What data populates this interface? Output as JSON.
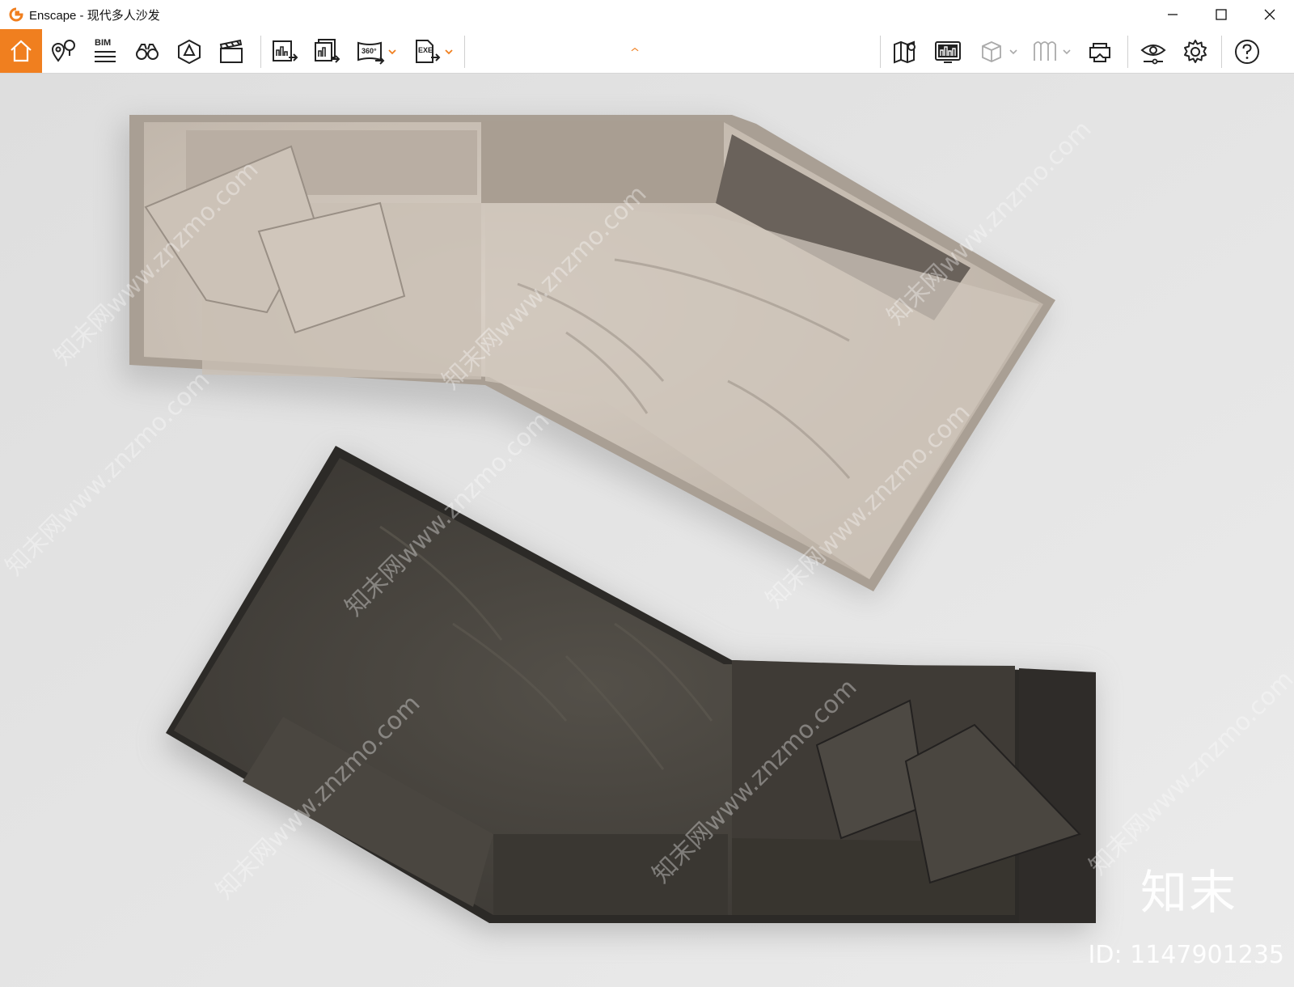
{
  "window": {
    "app_name": "Enscape",
    "separator": " - ",
    "document_name": "现代多人沙发"
  },
  "toolbar": {
    "bim_label": "BIM",
    "pano_label": "360°",
    "exe_label": "EXE"
  },
  "icons": {
    "accent": "#f07f1f",
    "items": [
      "home-icon",
      "location-pin-icon",
      "bim-info-icon",
      "binoculars-icon",
      "perspective-icon",
      "clapper-icon",
      "screenshot-export-icon",
      "batch-export-icon",
      "panorama-export-icon",
      "exe-export-icon",
      "map-icon",
      "asset-library-icon",
      "cube-view-icon",
      "material-icon",
      "vr-headset-icon",
      "visual-settings-icon",
      "settings-icon",
      "help-icon"
    ]
  },
  "watermark": {
    "logo_text": "知末",
    "id_text": "ID: 1147901235",
    "diagonal_text": "知末网www.znzmo.com"
  }
}
